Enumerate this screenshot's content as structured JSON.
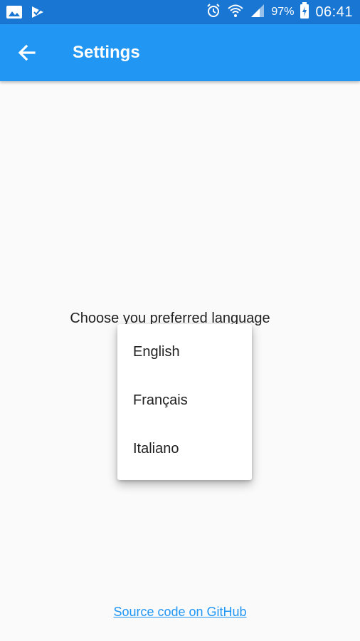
{
  "status_bar": {
    "battery": "97%",
    "time": "06:41",
    "icons": [
      "gallery-icon",
      "check-flag-icon",
      "alarm-icon",
      "wifi-icon",
      "signal-icon",
      "battery-charging-icon"
    ]
  },
  "app_bar": {
    "title": "Settings",
    "back_icon": "arrow-back-icon"
  },
  "main": {
    "prompt": "Choose you preferred language"
  },
  "language_menu": {
    "options": [
      "English",
      "Français",
      "Italiano"
    ]
  },
  "footer": {
    "link_text": "Source code on GitHub"
  },
  "colors": {
    "status_bar": "#1976d2",
    "app_bar": "#2196f3",
    "background": "#fafafa",
    "link": "#2196f3"
  }
}
